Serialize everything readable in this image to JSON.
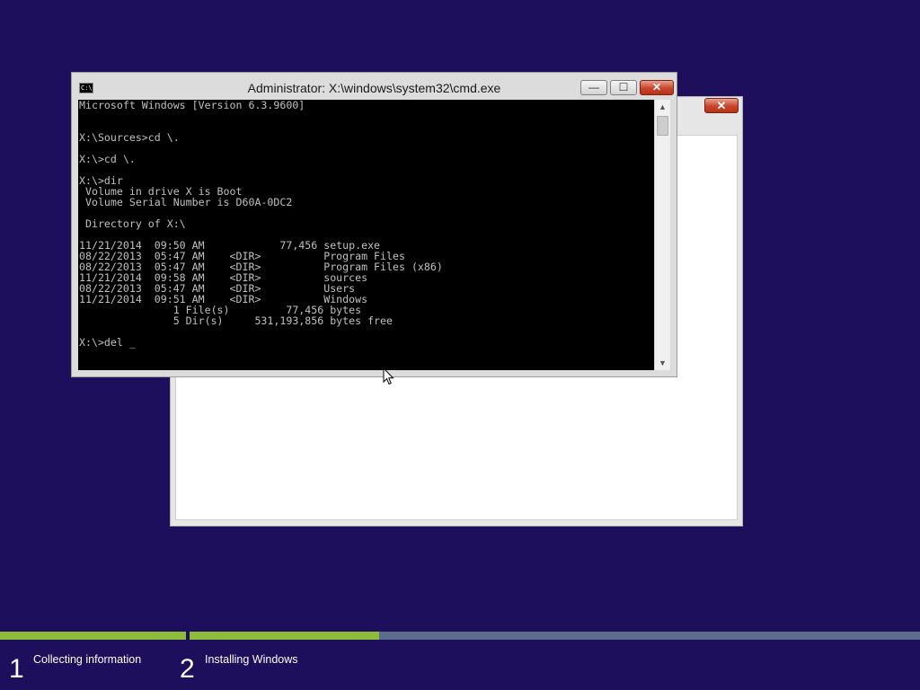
{
  "setup_window": {
    "close_label": "✕"
  },
  "cmd_window": {
    "title": "Administrator: X:\\windows\\system32\\cmd.exe",
    "icon_text": "C:\\",
    "min_label": "—",
    "max_label": "☐",
    "close_label": "✕",
    "lines": [
      "Microsoft Windows [Version 6.3.9600]",
      "",
      "",
      "X:\\Sources>cd \\.",
      "",
      "X:\\>cd \\.",
      "",
      "X:\\>dir",
      " Volume in drive X is Boot",
      " Volume Serial Number is D60A-0DC2",
      "",
      " Directory of X:\\",
      "",
      "11/21/2014  09:50 AM            77,456 setup.exe",
      "08/22/2013  05:47 AM    <DIR>          Program Files",
      "08/22/2013  05:47 AM    <DIR>          Program Files (x86)",
      "11/21/2014  09:58 AM    <DIR>          sources",
      "08/22/2013  05:47 AM    <DIR>          Users",
      "11/21/2014  09:51 AM    <DIR>          Windows",
      "               1 File(s)         77,456 bytes",
      "               5 Dir(s)     531,193,856 bytes free",
      "",
      "X:\\>del "
    ],
    "cursor": "_",
    "scroll_up_label": "▲",
    "scroll_down_label": "▼"
  },
  "progress": {
    "stages": [
      {
        "number": "1",
        "label": "Collecting information",
        "fill_fraction": 1.0
      },
      {
        "number": "2",
        "label": "Installing Windows",
        "fill_fraction": 0.26
      }
    ],
    "colors": {
      "fill": "#8cbc3a",
      "track": "#5b6c8c",
      "background": "#1e0f5c"
    }
  }
}
